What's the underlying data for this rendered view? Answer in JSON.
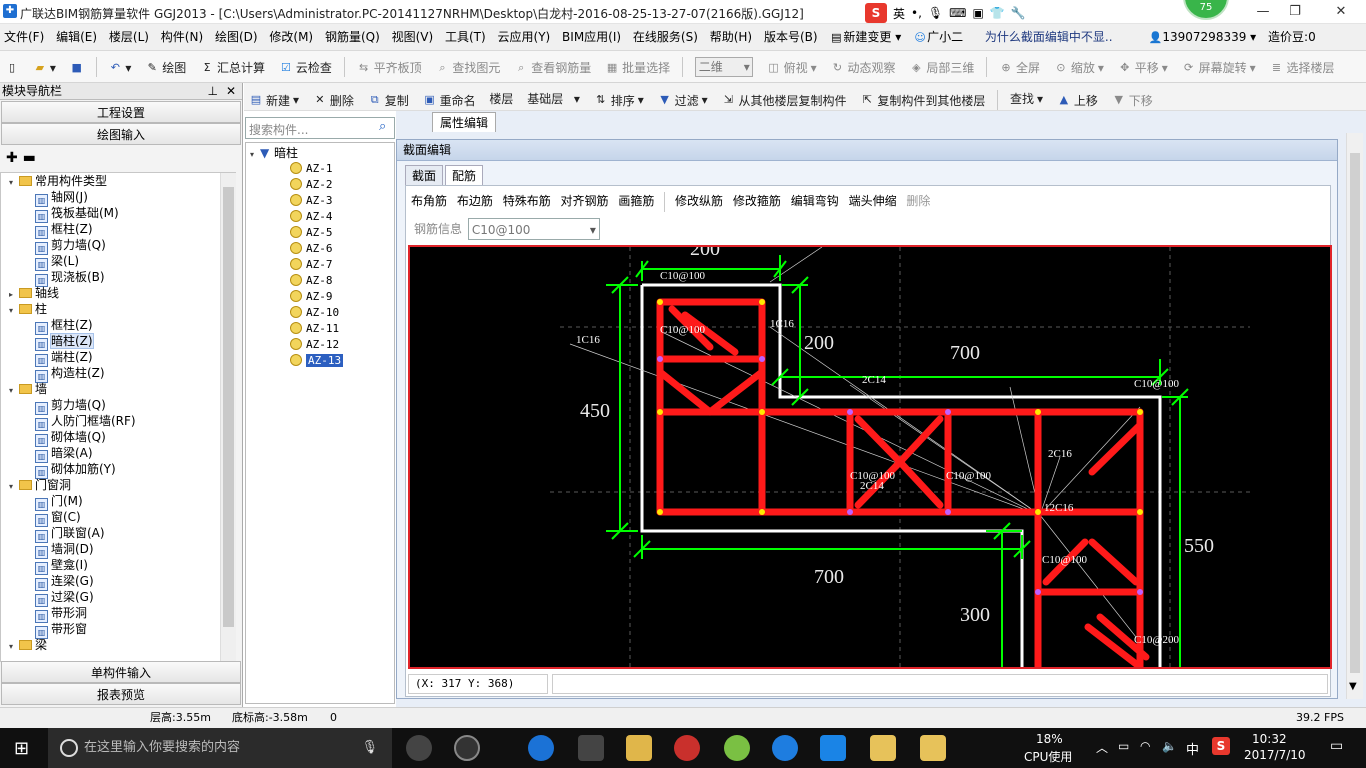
{
  "window": {
    "title": "广联达BIM钢筋算量软件 GGJ2013 - [C:\\Users\\Administrator.PC-20141127NRHM\\Desktop\\白龙村-2016-08-25-13-27-07(2166版).GGJ12]",
    "badge": "75"
  },
  "ime": {
    "mode": "英"
  },
  "menu": [
    "文件(F)",
    "编辑(E)",
    "楼层(L)",
    "构件(N)",
    "绘图(D)",
    "修改(M)",
    "钢筋量(Q)",
    "视图(V)",
    "工具(T)",
    "云应用(Y)",
    "BIM应用(I)",
    "在线服务(S)",
    "帮助(H)",
    "版本号(B)",
    "新建变更",
    "广小二",
    "为什么截面编辑中不显..",
    "13907298339",
    "造价豆:0"
  ],
  "toolbar1": {
    "draw": "绘图",
    "sum": "汇总计算",
    "cloud": "云检查",
    "level_top": "平齐板顶",
    "find": "查找图元",
    "view_rebar": "查看钢筋量",
    "batch": "批量选择",
    "view_mode": "二维",
    "top_view": "俯视",
    "dynamic": "动态观察",
    "local3d": "局部三维",
    "fullscreen": "全屏",
    "zoom": "缩放",
    "pan": "平移",
    "rotate": "屏幕旋转",
    "select_floor": "选择楼层"
  },
  "toolbar2": {
    "new": "新建",
    "delete": "删除",
    "copy": "复制",
    "rename": "重命名",
    "floor_label": "楼层",
    "floor_value": "基础层",
    "sort": "排序",
    "filter": "过滤",
    "copy_from": "从其他楼层复制构件",
    "copy_to": "复制构件到其他楼层",
    "find": "查找",
    "up": "上移",
    "down": "下移"
  },
  "nav": {
    "header": "模块导航栏",
    "project": "工程设置",
    "draw_input": "绘图输入",
    "single_input": "单构件输入",
    "report": "报表预览",
    "tree": [
      {
        "t": "常用构件类型",
        "lvl": 0,
        "folder": true,
        "open": true
      },
      {
        "t": "轴网(J)",
        "lvl": 1
      },
      {
        "t": "筏板基础(M)",
        "lvl": 1
      },
      {
        "t": "框柱(Z)",
        "lvl": 1
      },
      {
        "t": "剪力墙(Q)",
        "lvl": 1
      },
      {
        "t": "梁(L)",
        "lvl": 1
      },
      {
        "t": "现浇板(B)",
        "lvl": 1
      },
      {
        "t": "轴线",
        "lvl": 0,
        "folder": true,
        "open": false
      },
      {
        "t": "柱",
        "lvl": 0,
        "folder": true,
        "open": true
      },
      {
        "t": "框柱(Z)",
        "lvl": 1
      },
      {
        "t": "暗柱(Z)",
        "lvl": 1,
        "sel": true
      },
      {
        "t": "端柱(Z)",
        "lvl": 1
      },
      {
        "t": "构造柱(Z)",
        "lvl": 1
      },
      {
        "t": "墙",
        "lvl": 0,
        "folder": true,
        "open": true
      },
      {
        "t": "剪力墙(Q)",
        "lvl": 1
      },
      {
        "t": "人防门框墙(RF)",
        "lvl": 1
      },
      {
        "t": "砌体墙(Q)",
        "lvl": 1
      },
      {
        "t": "暗梁(A)",
        "lvl": 1
      },
      {
        "t": "砌体加筋(Y)",
        "lvl": 1
      },
      {
        "t": "门窗洞",
        "lvl": 0,
        "folder": true,
        "open": true
      },
      {
        "t": "门(M)",
        "lvl": 1
      },
      {
        "t": "窗(C)",
        "lvl": 1
      },
      {
        "t": "门联窗(A)",
        "lvl": 1
      },
      {
        "t": "墙洞(D)",
        "lvl": 1
      },
      {
        "t": "壁龛(I)",
        "lvl": 1
      },
      {
        "t": "连梁(G)",
        "lvl": 1
      },
      {
        "t": "过梁(G)",
        "lvl": 1
      },
      {
        "t": "带形洞",
        "lvl": 1
      },
      {
        "t": "带形窗",
        "lvl": 1
      },
      {
        "t": "梁",
        "lvl": 0,
        "folder": true,
        "open": true
      }
    ]
  },
  "components": {
    "search_placeholder": "搜索构件...",
    "root": "暗柱",
    "items": [
      "AZ-1",
      "AZ-2",
      "AZ-3",
      "AZ-4",
      "AZ-5",
      "AZ-6",
      "AZ-7",
      "AZ-8",
      "AZ-9",
      "AZ-10",
      "AZ-11",
      "AZ-12",
      "AZ-13"
    ],
    "selected": "AZ-13"
  },
  "property_tab": "属性编辑",
  "dialog": {
    "title": "截面编辑",
    "tabs": [
      "截面",
      "配筋"
    ],
    "tools": [
      "布角筋",
      "布边筋",
      "特殊布筋",
      "对齐钢筋",
      "画箍筋",
      "修改纵筋",
      "修改箍筋",
      "编辑弯钩",
      "端头伸缩",
      "删除"
    ],
    "rebar_info_label": "钢筋信息",
    "rebar_info_value": "C10@100",
    "coord": "(X: 317 Y: 368)"
  },
  "drawing": {
    "dims": [
      "200",
      "450",
      "200",
      "700",
      "700",
      "300",
      "550"
    ],
    "labels": [
      "C10@100",
      "C10@100",
      "1C16",
      "1C16",
      "2C14",
      "C10@100",
      "2C16",
      "C10@100",
      "2C14",
      "C10@100",
      "12C16",
      "C10@100",
      "C10@200"
    ]
  },
  "status": {
    "floor_height": "层高:3.55m",
    "bottom_height": "底标高:-3.58m",
    "zero": "0",
    "fps": "39.2 FPS"
  },
  "taskbar": {
    "search": "在这里输入你要搜索的内容",
    "cpu_pct": "18%",
    "cpu_label": "CPU使用",
    "lang": "中",
    "time": "10:32",
    "date": "2017/7/10"
  },
  "colors": {
    "rebar": "#ff1a1a",
    "dim": "#00ff00",
    "outline": "#ffffff",
    "canvas_border": "#e0242a"
  }
}
